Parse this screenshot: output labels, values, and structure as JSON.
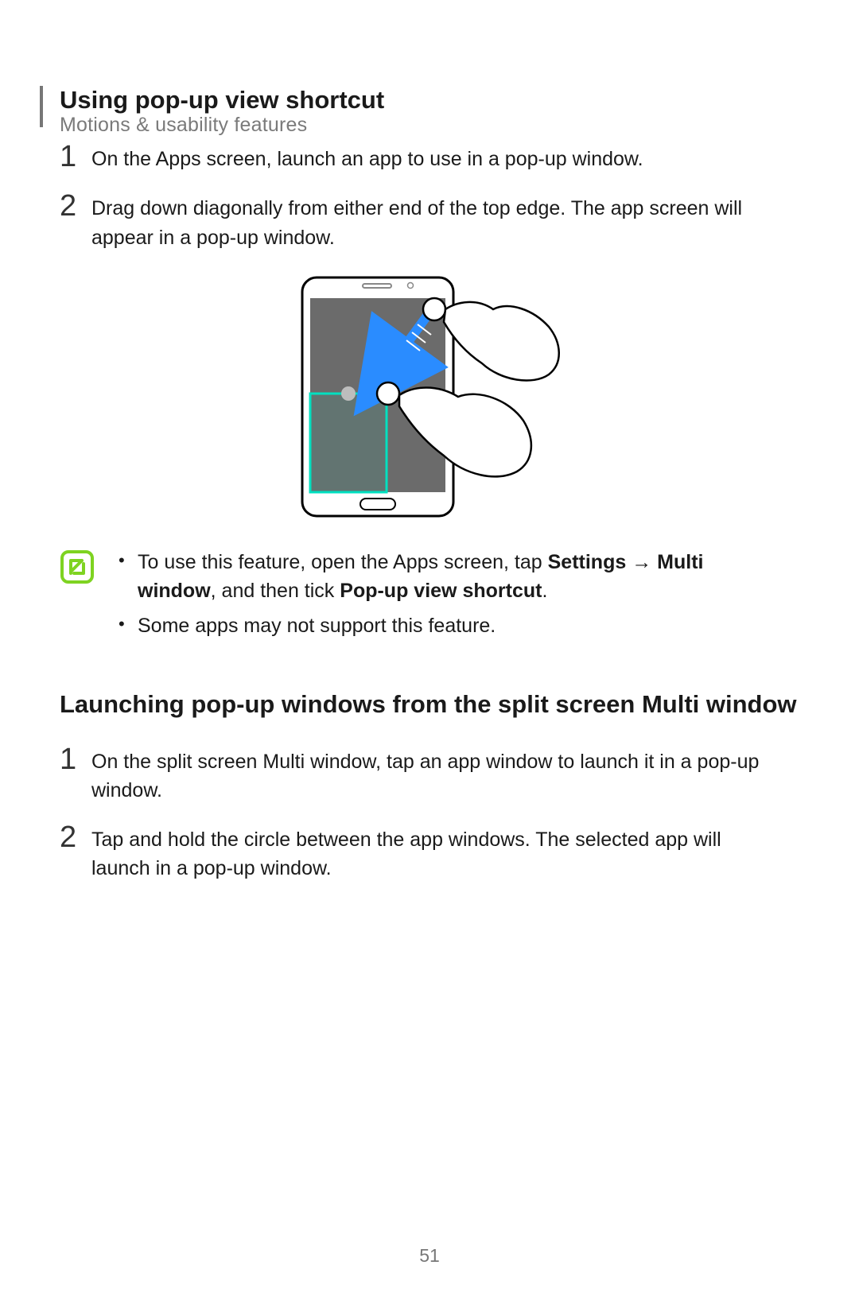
{
  "header": {
    "breadcrumb": "Motions & usability features"
  },
  "section1": {
    "title": "Using pop-up view shortcut",
    "steps": [
      {
        "num": "1",
        "text": "On the Apps screen, launch an app to use in a pop-up window."
      },
      {
        "num": "2",
        "text": "Drag down diagonally from either end of the top edge. The app screen will appear in a pop-up window."
      }
    ]
  },
  "note": {
    "bullets": {
      "b1_pre": "To use this feature, open the Apps screen, tap ",
      "b1_bold1": "Settings",
      "b1_arrow": " → ",
      "b1_bold2": "Multi window",
      "b1_mid": ", and then tick ",
      "b1_bold3": "Pop-up view shortcut",
      "b1_post": ".",
      "b2": "Some apps may not support this feature."
    }
  },
  "section2": {
    "title": "Launching pop-up windows from the split screen Multi window",
    "steps": [
      {
        "num": "1",
        "text": "On the split screen Multi window, tap an app window to launch it in a pop-up window."
      },
      {
        "num": "2",
        "text": "Tap and hold the circle between the app windows. The selected app will launch in a pop-up window."
      }
    ]
  },
  "page_number": "51",
  "colors": {
    "note_icon": "#7ed321",
    "arrow": "#2a8cff",
    "highlight": "#00e0c0"
  }
}
